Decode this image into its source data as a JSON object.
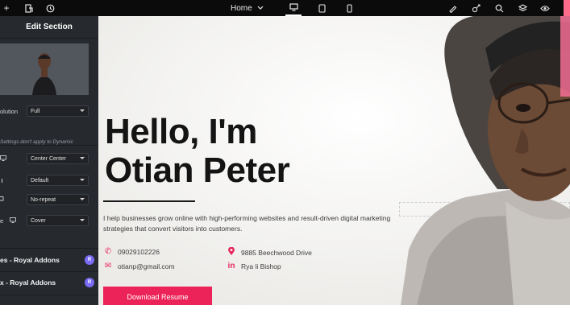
{
  "topbar": {
    "page_selector": "Home",
    "icons_left": [
      "plus-icon",
      "structure-icon",
      "history-icon"
    ],
    "devices": [
      "desktop-icon",
      "tablet-icon",
      "mobile-icon"
    ],
    "icons_right": [
      "paint-icon",
      "plug-icon",
      "search-icon",
      "layers-icon",
      "eye-icon"
    ]
  },
  "sidebar": {
    "title": "Edit Section",
    "resolution_label": "olution",
    "resolution_value": "Full",
    "note": "Settings don't apply to Dynamic",
    "position_value": "Center Center",
    "attachment_value": "Default",
    "repeat_value": "No-repeat",
    "size_label": "e",
    "size_value": "Cover",
    "addon_1": "es - Royal Addons",
    "addon_2": "x - Royal Addons",
    "badge": "R"
  },
  "hero": {
    "headline_line1": "Hello, I'm",
    "headline_line2": "Otian Peter",
    "intro": "I help businesses grow online with high-performing websites and result-driven digital marketing strategies that convert visitors into customers.",
    "phone": "09029102226",
    "email": "otianp@gmail.com",
    "address": "9885 Beechwood Drive",
    "linkedin": "Rya li Bishop",
    "download_button": "Download Resume"
  },
  "colors": {
    "accent": "#ec2358",
    "sidebar_bg": "#26292e",
    "topbar_bg": "#0b0b0b",
    "canvas_bg": "#f3f2f0"
  }
}
